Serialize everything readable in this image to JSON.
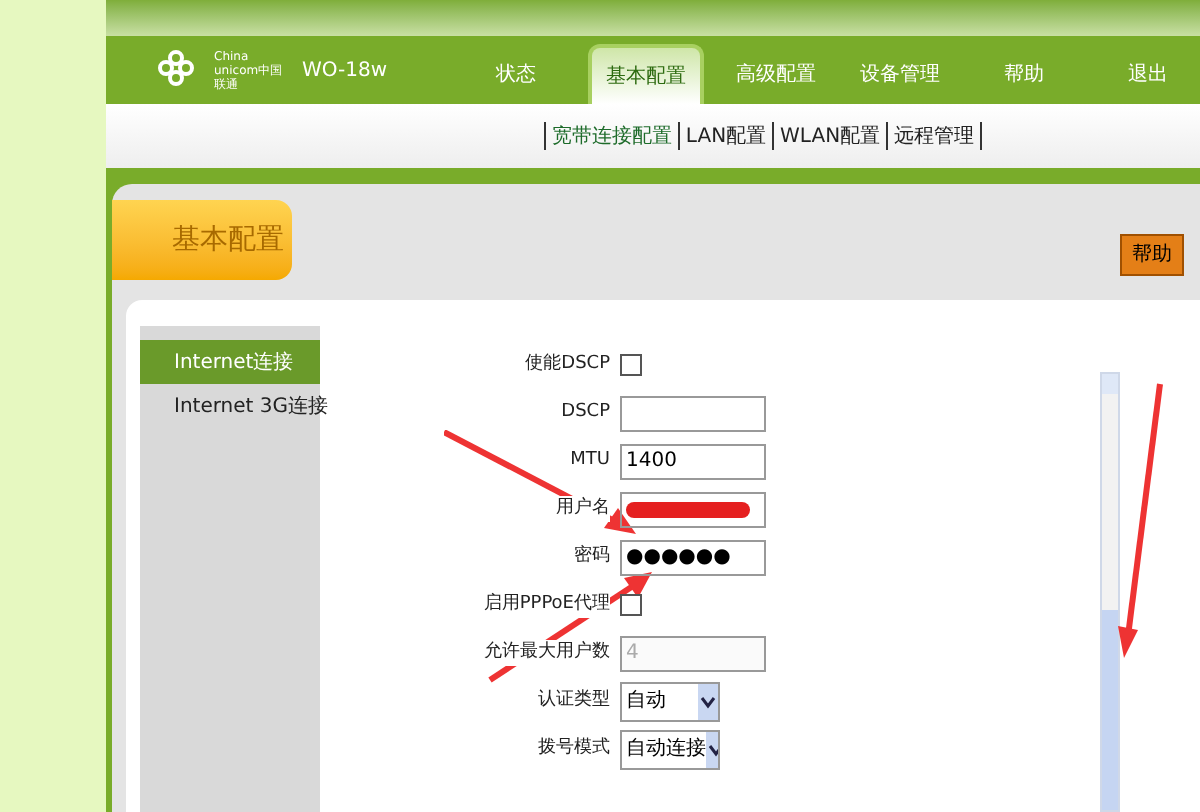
{
  "header": {
    "logo_text": "China unicom中国联通",
    "model": "WO-18w"
  },
  "nav": [
    {
      "label": "状态",
      "selected": false
    },
    {
      "label": "基本配置",
      "selected": true
    },
    {
      "label": "高级配置",
      "selected": false
    },
    {
      "label": "设备管理",
      "selected": false
    },
    {
      "label": "帮助",
      "selected": false
    },
    {
      "label": "退出",
      "selected": false
    }
  ],
  "subnav": [
    {
      "label": "宽带连接配置",
      "selected": true
    },
    {
      "label": "LAN配置",
      "selected": false
    },
    {
      "label": "WLAN配置",
      "selected": false
    },
    {
      "label": "远程管理",
      "selected": false
    }
  ],
  "section_title": "基本配置",
  "help_button": "帮助",
  "sidebar": [
    {
      "label": "Internet连接",
      "selected": true
    },
    {
      "label": "Internet 3G连接",
      "selected": false
    }
  ],
  "form": [
    {
      "kind": "checkbox",
      "label": "使能DSCP",
      "checked": false
    },
    {
      "kind": "text",
      "label": "DSCP"
    },
    {
      "kind": "text",
      "label": "MTU",
      "value": "1400"
    },
    {
      "kind": "redacted",
      "label": "用户名"
    },
    {
      "kind": "password",
      "label": "密码",
      "value": "●●●●●●"
    },
    {
      "kind": "checkbox",
      "label": "启用PPPoE代理",
      "checked": false
    },
    {
      "kind": "text",
      "label": "允许最大用户数",
      "value": "4",
      "disabled": true
    },
    {
      "kind": "select",
      "label": "认证类型",
      "value": "自动"
    },
    {
      "kind": "select",
      "label": "拨号模式",
      "value": "自动连接"
    }
  ]
}
